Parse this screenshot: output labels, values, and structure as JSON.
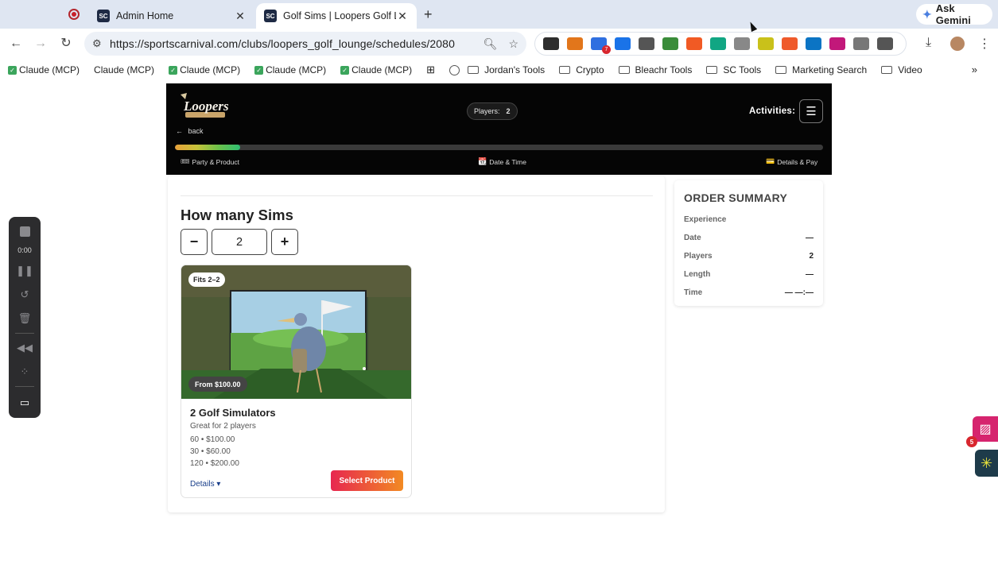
{
  "browser": {
    "tabs": [
      {
        "title": "Admin Home",
        "favicon": "SC"
      },
      {
        "title": "Golf Sims | Loopers Golf Loun",
        "favicon": "SC"
      }
    ],
    "ask_gemini": "Ask Gemini",
    "url": "https://sportscarnival.com/clubs/loopers_golf_lounge/schedules/2080",
    "bookmarks": [
      {
        "label": "Claude (MCP)",
        "check": true
      },
      {
        "label": "Claude (MCP)",
        "check": false
      },
      {
        "label": "Claude (MCP)",
        "check": true
      },
      {
        "label": "Claude (MCP)",
        "check": true
      },
      {
        "label": "Claude (MCP)",
        "check": true
      }
    ],
    "bookmark_folders": [
      "Jordan's Tools",
      "Crypto",
      "Bleachr Tools",
      "SC Tools",
      "Marketing Search",
      "Video"
    ],
    "extension_colors": [
      "#2d2d2d",
      "#e2761b",
      "#2f6fe0",
      "#1a73e8",
      "#555555",
      "#3a8c3a",
      "#f15a24",
      "#11a683",
      "#888888",
      "#c9c11a",
      "#ef5a2b",
      "#0b74c4",
      "#c2187a",
      "#777777",
      "#555555"
    ],
    "extension_badge": "7"
  },
  "recorder": {
    "time": "0:00"
  },
  "header": {
    "logo_text": "Loopers",
    "players_label": "Players:",
    "players_count": "2",
    "activities_label": "Activities:",
    "back_label": "back",
    "progress_fraction": 0.1,
    "steps": [
      {
        "icon": "🎟",
        "label": "Party & Product"
      },
      {
        "icon": "📆",
        "label": "Date & Time"
      },
      {
        "icon": "💳",
        "label": "Details & Pay"
      }
    ]
  },
  "booking": {
    "title": "How many Sims",
    "quantity": "2",
    "minus": "−",
    "plus": "+"
  },
  "product": {
    "fits": "Fits 2–2",
    "from_price": "From $100.00",
    "name": "2 Golf Simulators",
    "subtitle": "Great for 2 players",
    "prices": [
      "60 • $100.00",
      "30 • $60.00",
      "120 • $200.00"
    ],
    "details_label": "Details ▾",
    "select_label": "Select Product"
  },
  "summary": {
    "title": "ORDER SUMMARY",
    "rows": [
      {
        "label": "Experience",
        "value": ""
      },
      {
        "label": "Date",
        "value": "—"
      },
      {
        "label": "Players",
        "value": "2"
      },
      {
        "label": "Length",
        "value": "—"
      },
      {
        "label": "Time",
        "value": "— —:—"
      }
    ]
  },
  "floating": {
    "badge": "5"
  },
  "colors": {
    "header_bg": "#050505",
    "select_gradient_start": "#e7274f",
    "select_gradient_end": "#f28a23",
    "link": "#1a3f8a"
  }
}
